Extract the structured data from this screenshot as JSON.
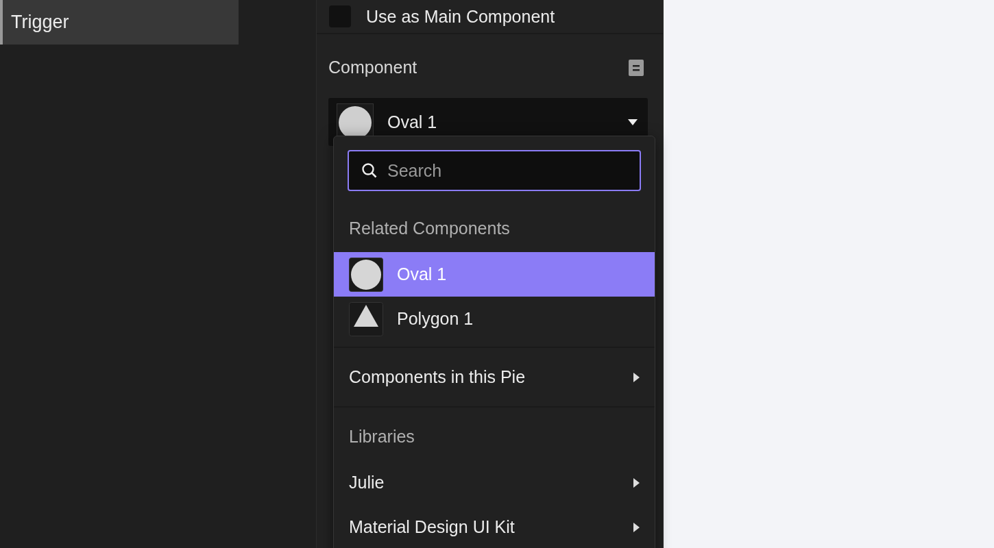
{
  "sidebar": {
    "items": [
      {
        "label": "Trigger",
        "selected": true
      }
    ]
  },
  "panel": {
    "main_component_checkbox": {
      "label": "Use as Main Component",
      "checked": false
    },
    "component_section": {
      "title": "Component",
      "select": {
        "value": "Oval 1"
      }
    }
  },
  "dropdown": {
    "search": {
      "placeholder": "Search"
    },
    "sections": [
      {
        "heading": "Related Components",
        "items": [
          {
            "label": "Oval 1",
            "kind": "oval",
            "selected": true
          },
          {
            "label": "Polygon 1",
            "kind": "triangle",
            "selected": false
          }
        ]
      },
      {
        "items": [
          {
            "label": "Components in this Pie",
            "kind": "submenu",
            "selected": false
          }
        ]
      },
      {
        "heading": "Libraries",
        "items": [
          {
            "label": "Julie",
            "kind": "submenu",
            "selected": false
          },
          {
            "label": "Material Design UI Kit",
            "kind": "submenu",
            "selected": false
          }
        ]
      }
    ]
  }
}
